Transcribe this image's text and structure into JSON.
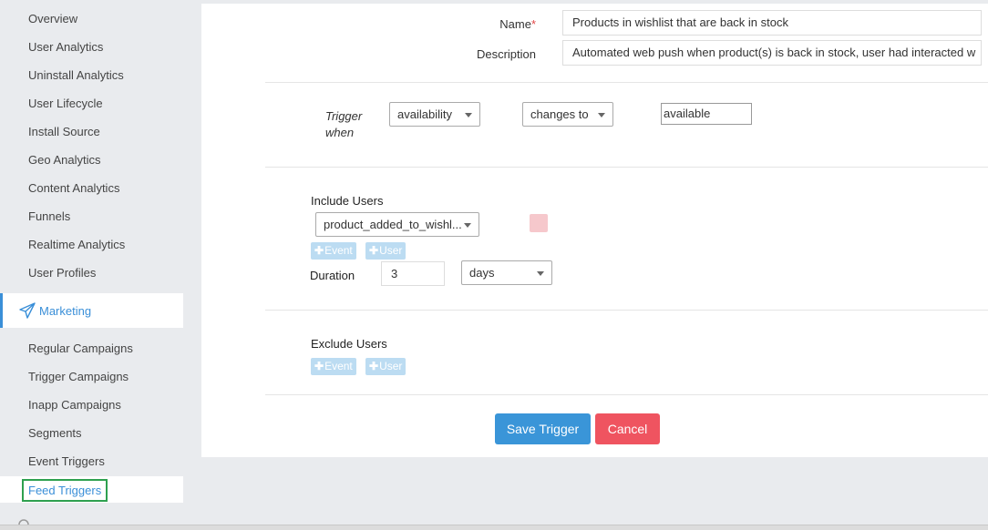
{
  "sidebar": {
    "analytics_items": [
      {
        "label": "Overview"
      },
      {
        "label": "User Analytics"
      },
      {
        "label": "Uninstall Analytics"
      },
      {
        "label": "User Lifecycle"
      },
      {
        "label": "Install Source"
      },
      {
        "label": "Geo Analytics"
      },
      {
        "label": "Content Analytics"
      },
      {
        "label": "Funnels"
      },
      {
        "label": "Realtime Analytics"
      },
      {
        "label": "User Profiles"
      }
    ],
    "section": {
      "label": "Marketing",
      "icon": "paper-plane-icon"
    },
    "marketing_items": [
      {
        "label": "Regular Campaigns"
      },
      {
        "label": "Trigger Campaigns"
      },
      {
        "label": "Inapp Campaigns"
      },
      {
        "label": "Segments"
      },
      {
        "label": "Event Triggers"
      }
    ],
    "selected_item": {
      "label": "Feed Triggers"
    }
  },
  "form": {
    "name_label": "Name",
    "required_mark": "*",
    "name_value": "Products in wishlist that are back in stock",
    "description_label": "Description",
    "description_value": "Automated web push when product(s) is back in stock, user had interacted w",
    "trigger": {
      "label": "Trigger when",
      "attribute": "availability",
      "operator": "changes to",
      "value": "available"
    },
    "include": {
      "title": "Include Users",
      "event_select": "product_added_to_wishl...",
      "add_event_label": "Event",
      "add_user_label": "User",
      "duration_label": "Duration",
      "duration_value": "3",
      "duration_unit": "days"
    },
    "exclude": {
      "title": "Exclude Users",
      "add_event_label": "Event",
      "add_user_label": "User"
    },
    "save_label": "Save Trigger",
    "cancel_label": "Cancel"
  },
  "colors": {
    "accent": "#3a8fd8",
    "save": "#3a95d8",
    "cancel": "#ef5460",
    "selected_outline": "#2ea04f"
  }
}
